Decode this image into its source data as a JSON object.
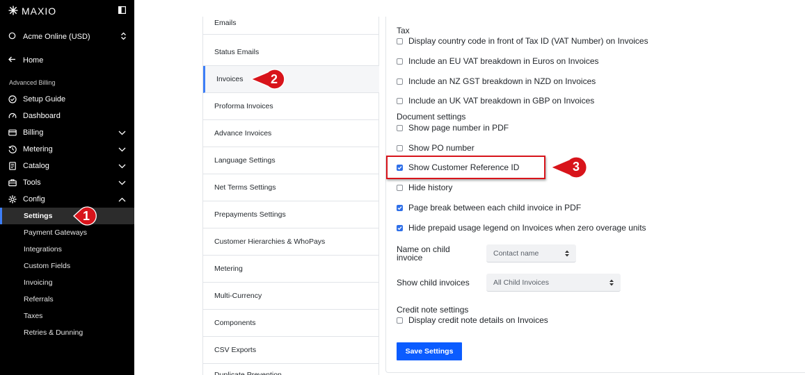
{
  "sidebar": {
    "brand": "MAXIO",
    "org": "Acme Online (USD)",
    "home": "Home",
    "section": "Advanced Billing",
    "items": [
      {
        "label": "Setup Guide"
      },
      {
        "label": "Dashboard"
      },
      {
        "label": "Billing"
      },
      {
        "label": "Metering"
      },
      {
        "label": "Catalog"
      },
      {
        "label": "Tools"
      },
      {
        "label": "Config"
      }
    ],
    "config_items": [
      {
        "label": "Settings"
      },
      {
        "label": "Payment Gateways"
      },
      {
        "label": "Integrations"
      },
      {
        "label": "Custom Fields"
      },
      {
        "label": "Invoicing"
      },
      {
        "label": "Referrals"
      },
      {
        "label": "Taxes"
      },
      {
        "label": "Retries & Dunning"
      }
    ]
  },
  "settings_menu": [
    {
      "label": "Emails"
    },
    {
      "label": "Status Emails"
    },
    {
      "label": "Invoices"
    },
    {
      "label": "Proforma Invoices"
    },
    {
      "label": "Advance Invoices"
    },
    {
      "label": "Language Settings"
    },
    {
      "label": "Net Terms Settings"
    },
    {
      "label": "Prepayments Settings"
    },
    {
      "label": "Customer Hierarchies & WhoPays"
    },
    {
      "label": "Metering"
    },
    {
      "label": "Multi-Currency"
    },
    {
      "label": "Components"
    },
    {
      "label": "CSV Exports"
    },
    {
      "label": "Duplicate Prevention"
    }
  ],
  "panel": {
    "tax_heading": "Tax",
    "tax_options": [
      {
        "label": "Display country code in front of Tax ID (VAT Number) on Invoices",
        "checked": false
      },
      {
        "label": "Include an EU VAT breakdown in Euros on Invoices",
        "checked": false
      },
      {
        "label": "Include an NZ GST breakdown in NZD on Invoices",
        "checked": false
      },
      {
        "label": "Include an UK VAT breakdown in GBP on Invoices",
        "checked": false
      }
    ],
    "doc_heading": "Document settings",
    "doc_options": [
      {
        "label": "Show page number in PDF",
        "checked": false
      },
      {
        "label": "Show PO number",
        "checked": false
      },
      {
        "label": "Show Customer Reference ID",
        "checked": true
      },
      {
        "label": "Hide history",
        "checked": false
      },
      {
        "label": "Page break between each child invoice in PDF",
        "checked": true
      },
      {
        "label": "Hide prepaid usage legend on Invoices when zero overage units",
        "checked": true
      }
    ],
    "name_on_child_label": "Name on child invoice",
    "name_on_child_value": "Contact name",
    "show_child_label": "Show child invoices",
    "show_child_value": "All Child Invoices",
    "credit_heading": "Credit note settings",
    "credit_options": [
      {
        "label": "Display credit note details on Invoices",
        "checked": false
      }
    ],
    "save_label": "Save Settings"
  },
  "annotations": {
    "step1": "1",
    "step2": "2",
    "step3": "3",
    "color": "#d8141b"
  }
}
